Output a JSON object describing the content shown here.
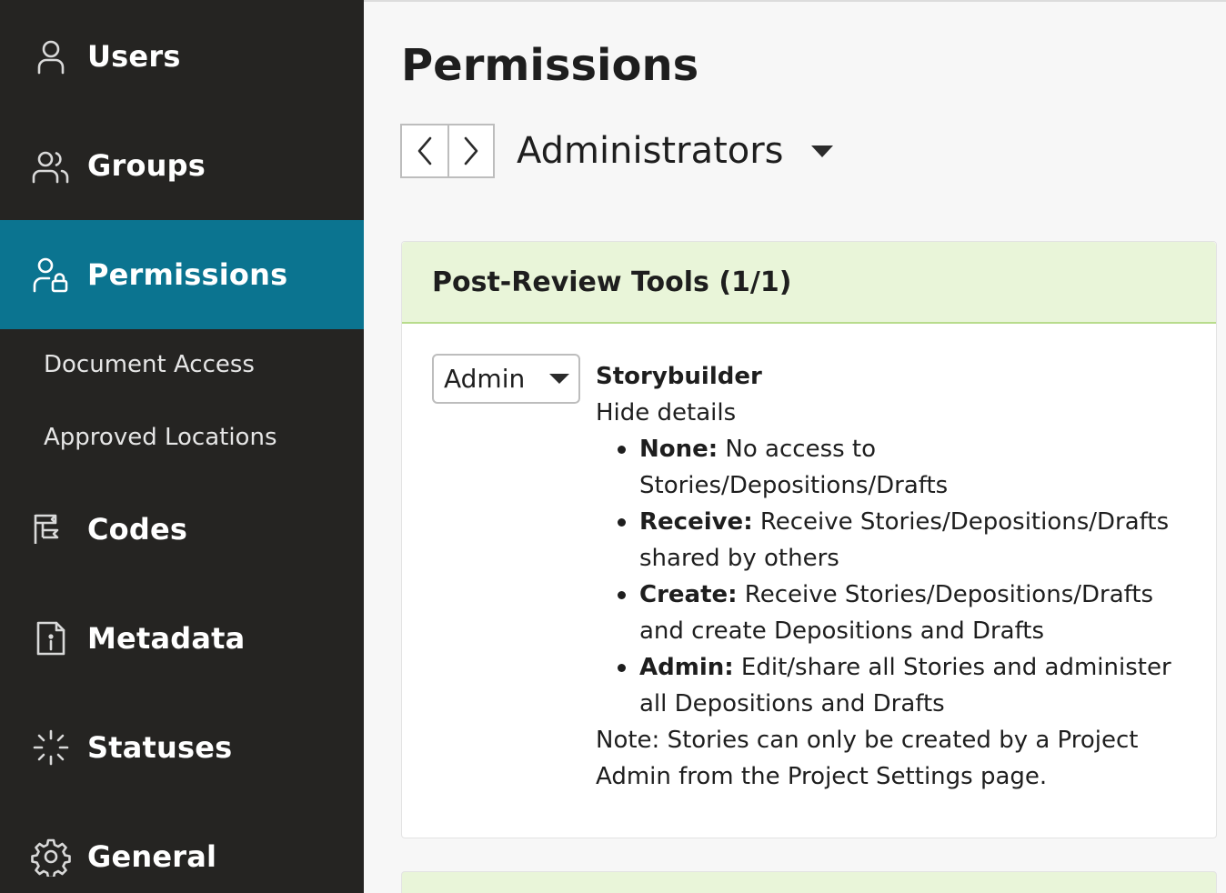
{
  "sidebar": {
    "items": [
      {
        "label": "Users",
        "icon": "user-icon"
      },
      {
        "label": "Groups",
        "icon": "group-icon"
      },
      {
        "label": "Permissions",
        "icon": "user-lock-icon",
        "active": true
      },
      {
        "label": "Codes",
        "icon": "codes-flag-icon"
      },
      {
        "label": "Metadata",
        "icon": "document-info-icon"
      },
      {
        "label": "Statuses",
        "icon": "loader-icon"
      },
      {
        "label": "General",
        "icon": "gear-icon"
      }
    ],
    "subitems": [
      {
        "label": "Document Access"
      },
      {
        "label": "Approved Locations"
      }
    ],
    "colors": {
      "background": "#252422",
      "active": "#0b7490"
    }
  },
  "main": {
    "title": "Permissions",
    "group_select": {
      "value": "Administrators"
    },
    "card": {
      "title": "Post-Review Tools (1/1)",
      "role_select": {
        "value": "Admin"
      },
      "tool_name": "Storybuilder",
      "toggle_label": "Hide details",
      "details": [
        {
          "term": "None:",
          "text": " No access to Stories/Depositions/Drafts"
        },
        {
          "term": "Receive:",
          "text": " Receive Stories/Depositions/Drafts shared by others"
        },
        {
          "term": "Create:",
          "text": " Receive Stories/Depositions/Drafts and create Depositions and Drafts"
        },
        {
          "term": "Admin:",
          "text": " Edit/share all Stories and administer all Depositions and Drafts"
        }
      ],
      "note": "Note: Stories can only be created by a Project Admin from the Project Settings page."
    },
    "colors": {
      "card_header": "#e9f5d9",
      "card_header_border": "#b8dc8c"
    }
  }
}
